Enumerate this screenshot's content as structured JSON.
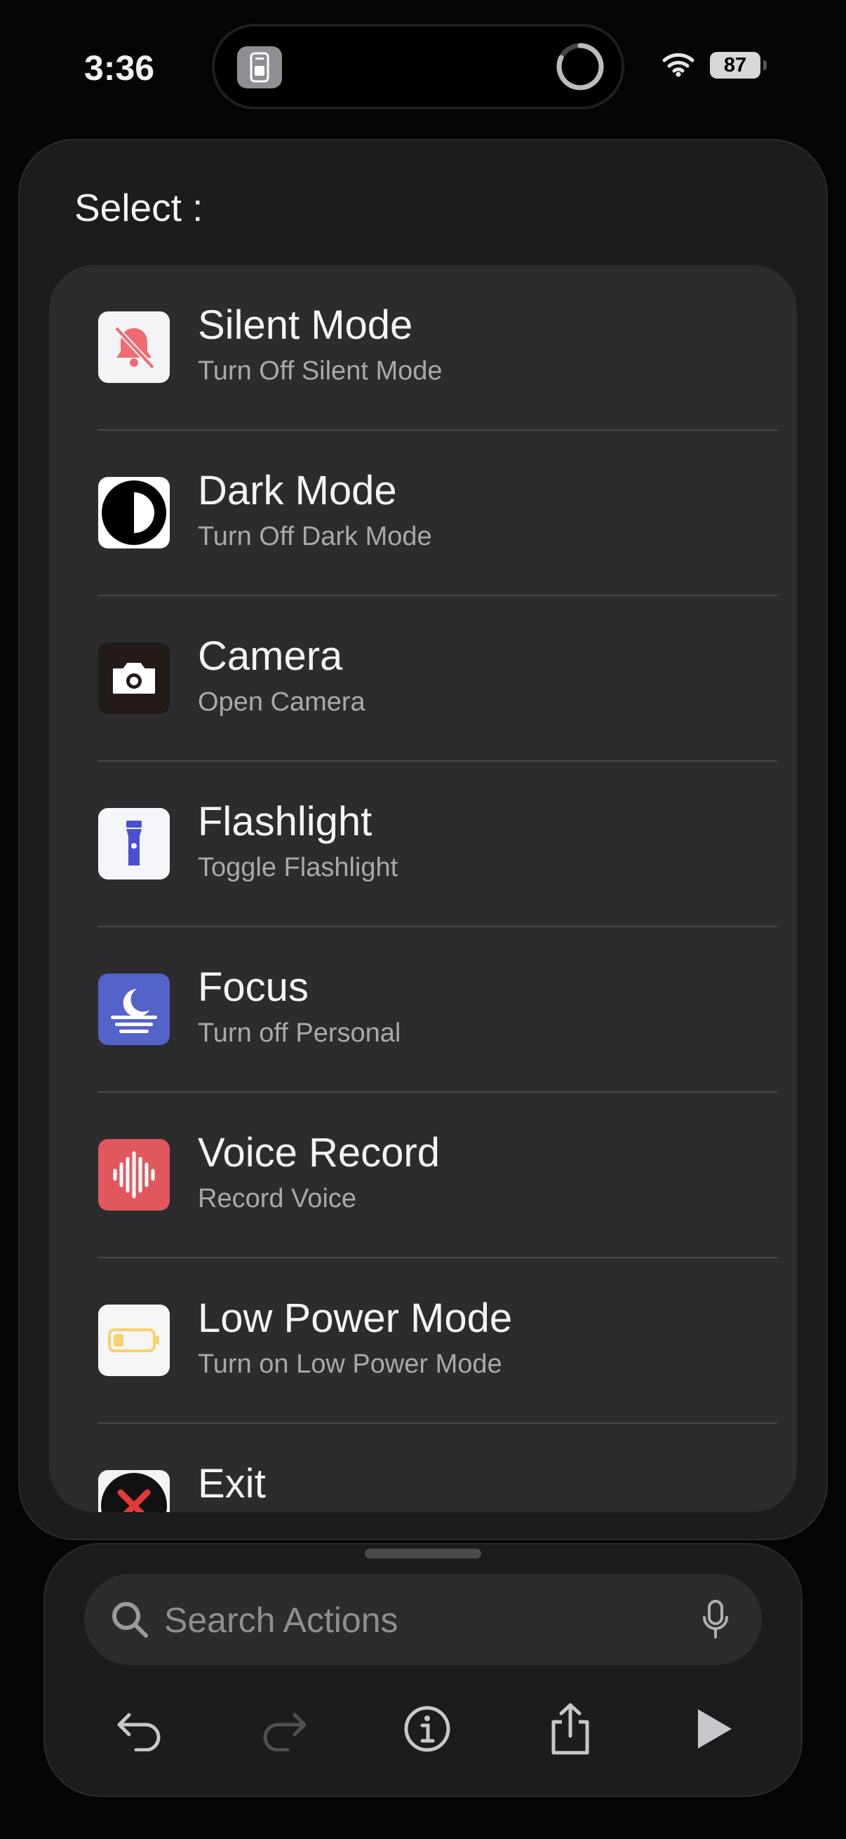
{
  "status_bar": {
    "time": "3:36",
    "battery": "87"
  },
  "sheet": {
    "title": "Select :"
  },
  "actions": [
    {
      "title": "Silent Mode",
      "subtitle": "Turn Off Silent Mode",
      "icon": "bell-slash-icon"
    },
    {
      "title": "Dark Mode",
      "subtitle": "Turn Off Dark Mode",
      "icon": "dark-mode-icon"
    },
    {
      "title": "Camera",
      "subtitle": "Open Camera",
      "icon": "camera-icon"
    },
    {
      "title": "Flashlight",
      "subtitle": "Toggle Flashlight",
      "icon": "flashlight-icon"
    },
    {
      "title": "Focus",
      "subtitle": "Turn off Personal",
      "icon": "focus-moon-icon"
    },
    {
      "title": "Voice Record",
      "subtitle": "Record Voice",
      "icon": "waveform-icon"
    },
    {
      "title": "Low Power Mode",
      "subtitle": "Turn on Low Power Mode",
      "icon": "low-battery-icon"
    },
    {
      "title": "Exit",
      "subtitle": "",
      "icon": "exit-x-icon"
    }
  ],
  "search": {
    "placeholder": "Search Actions"
  },
  "toolbar": {
    "buttons": [
      "undo-icon",
      "redo-icon",
      "info-icon",
      "share-icon",
      "play-icon"
    ]
  },
  "colors": {
    "background": "#050505",
    "sheet": "#1c1c1e",
    "list": "#2c2c2e",
    "secondary_text": "#a9a9ad"
  }
}
